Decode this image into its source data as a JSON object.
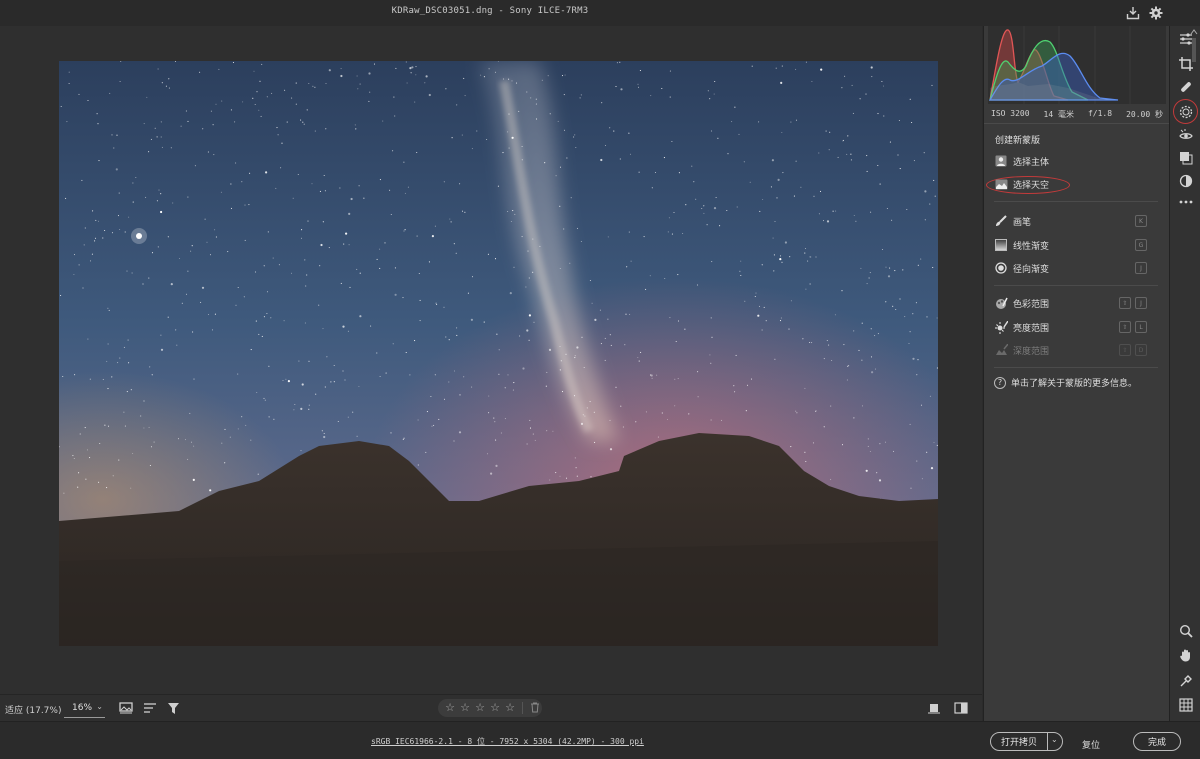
{
  "window": {
    "title": "KDRaw_DSC03051.dng - Sony ILCE-7RM3"
  },
  "histogram": {
    "channels": [
      "red",
      "green",
      "blue"
    ],
    "colors": {
      "red": "#e04848",
      "green": "#3fbf5a",
      "blue": "#4a7fe0"
    }
  },
  "exif": {
    "iso": "ISO 3200",
    "focal": "14 毫米",
    "aperture": "f/1.8",
    "shutter": "20.00 秒"
  },
  "mask_panel": {
    "title": "创建新蒙版",
    "items": [
      {
        "label": "选择主体",
        "icon": "subject-icon"
      },
      {
        "label": "选择天空",
        "icon": "sky-icon"
      },
      {
        "label": "画笔",
        "icon": "brush-icon",
        "shortcut": "K"
      },
      {
        "label": "线性渐变",
        "icon": "linear-gradient-icon",
        "shortcut": "G"
      },
      {
        "label": "径向渐变",
        "icon": "radial-gradient-icon",
        "shortcut": "J"
      },
      {
        "label": "色彩范围",
        "icon": "color-range-icon",
        "shortcut": "⇧ J"
      },
      {
        "label": "亮度范围",
        "icon": "luminance-range-icon",
        "shortcut": "⇧ L"
      },
      {
        "label": "深度范围",
        "icon": "depth-range-icon",
        "shortcut": "⇧ D",
        "disabled": true
      }
    ],
    "help": "单击了解关于蒙版的更多信息。"
  },
  "image_toolbar": {
    "zoom_fit": "适应 (17.7%)",
    "zoom_value": "16%",
    "stars": 5,
    "rating": 0
  },
  "status": {
    "file_info": "sRGB IEC61966-2.1 - 8 位 - 7952 x 5304 (42.2MP) - 300 ppi",
    "open_copy": "打开拷贝",
    "reset": "复位",
    "done": "完成"
  },
  "colors": {
    "highlight": "#c23a3a",
    "panel_bg": "#3a3a3a"
  }
}
